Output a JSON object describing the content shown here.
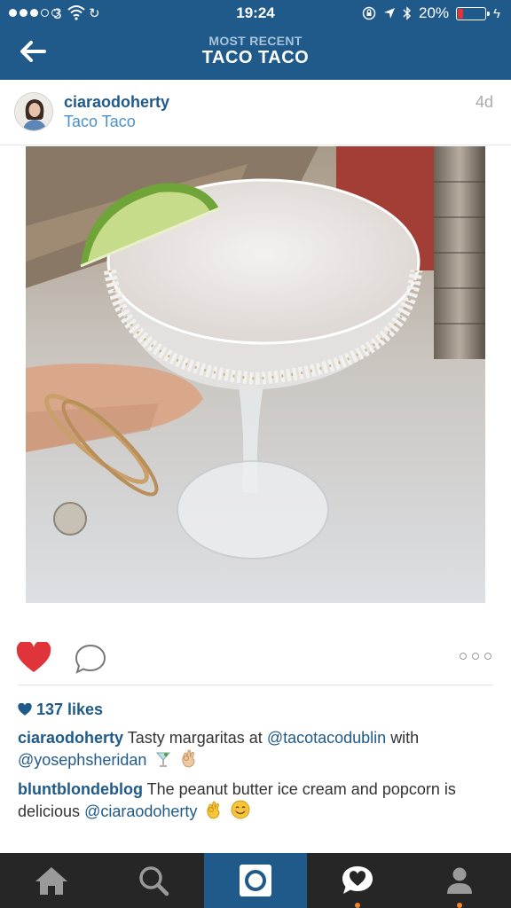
{
  "status_bar": {
    "carrier": "3",
    "time": "19:24",
    "battery_percent_text": "20%",
    "battery_level": 0.2
  },
  "header": {
    "subtitle": "MOST RECENT",
    "title": "TACO TACO"
  },
  "post": {
    "username": "ciaraodoherty",
    "location": "Taco Taco",
    "age": "4d",
    "likes": "137 likes",
    "liked": true
  },
  "comments": [
    {
      "user": "ciaraodoherty",
      "text_1": "Tasty margaritas at",
      "mention_1": "@tacotacodublin",
      "text_2": "with",
      "mention_2": "@yosephsheridan",
      "emojis": [
        "cocktail",
        "ok-hand"
      ]
    },
    {
      "user": "bluntblondeblog",
      "text_1": "The peanut butter ice cream and popcorn is delicious",
      "mention_1": "@ciaraodoherty",
      "emojis": [
        "ok-hand",
        "smiling-face"
      ]
    }
  ],
  "tab_bar": {
    "tabs": [
      {
        "icon": "home-icon"
      },
      {
        "icon": "search-icon"
      },
      {
        "icon": "camera-icon",
        "active": true
      },
      {
        "icon": "activity-heart-icon",
        "notification": true
      },
      {
        "icon": "profile-icon",
        "notification": true
      }
    ]
  },
  "colors": {
    "brand_blue": "#1f5a8a",
    "link_blue": "#4a90c9",
    "like_red": "#e0343b",
    "tab_bar_bg": "#262626",
    "notification_orange": "#f4852b"
  }
}
